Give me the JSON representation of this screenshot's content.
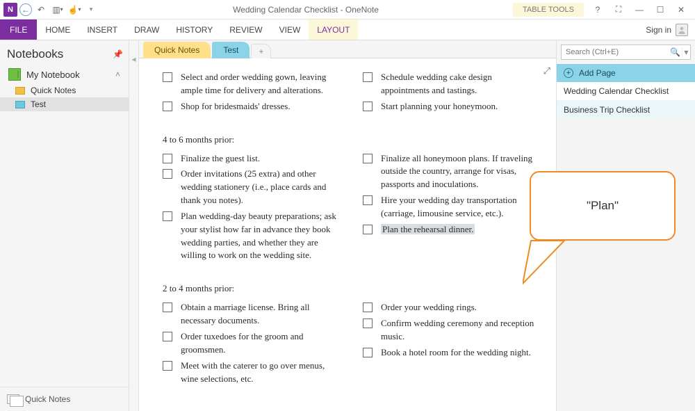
{
  "window": {
    "title": "Wedding Calendar Checklist - OneNote",
    "context_group": "TABLE TOOLS",
    "signin": "Sign in"
  },
  "ribbon": {
    "file": "FILE",
    "tabs": [
      "HOME",
      "INSERT",
      "DRAW",
      "HISTORY",
      "REVIEW",
      "VIEW"
    ],
    "context_tab": "LAYOUT"
  },
  "notebooks": {
    "header": "Notebooks",
    "current": "My Notebook",
    "sections": [
      {
        "label": "Quick Notes",
        "color": "yellow"
      },
      {
        "label": "Test",
        "color": "blue",
        "active": true
      }
    ],
    "footer": "Quick Notes"
  },
  "section_tabs": {
    "t0": "Quick Notes",
    "t1": "Test",
    "add": "+"
  },
  "search": {
    "placeholder": "Search (Ctrl+E)"
  },
  "rpanel": {
    "add_page": "Add Page",
    "pages": {
      "p0": "Wedding Calendar Checklist",
      "p1": "Business Trip Checklist"
    }
  },
  "content": {
    "g1": {
      "l0": "Select and order wedding gown, leaving ample time for delivery and alterations.",
      "l1": "Shop for bridesmaids' dresses.",
      "r0": "Schedule wedding cake design appointments and tastings.",
      "r1": "Start planning your honeymoon."
    },
    "h1": "4 to 6 months prior:",
    "g2": {
      "l0": "Finalize the guest list.",
      "l1": "Order invitations (25 extra) and other wedding stationery (i.e., place cards and thank you notes).",
      "l2": "Plan wedding-day beauty preparations; ask your stylist how far in advance they book wedding parties, and whether they are willing to work on the wedding site.",
      "r0": "Finalize all honeymoon plans. If traveling outside the country, arrange for visas, passports and inoculations.",
      "r1": "Hire your wedding day transportation (carriage, limousine service, etc.).",
      "r2": "Plan the rehearsal dinner."
    },
    "h2": "2 to 4 months prior:",
    "g3": {
      "l0": "Obtain a marriage license. Bring all necessary documents.",
      "l1": "Order tuxedoes for the groom and groomsmen.",
      "l2": "Meet with the caterer to go over menus, wine selections, etc.",
      "r0": "Order your wedding rings.",
      "r1": "Confirm wedding ceremony and reception music.",
      "r2": "Book a hotel room for the wedding night."
    }
  },
  "callout": {
    "text": "\"Plan\""
  }
}
